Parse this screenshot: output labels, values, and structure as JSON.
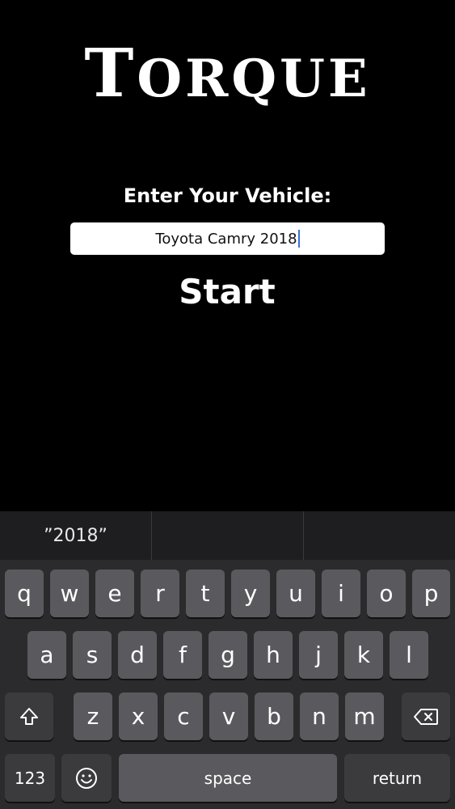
{
  "app": {
    "title_first": "T",
    "title_rest": "ORQUE"
  },
  "form": {
    "label": "Enter Your Vehicle:",
    "vehicle_value": "Toyota Camry 2018",
    "start_label": "Start"
  },
  "keyboard": {
    "suggestions": [
      "”2018”",
      "",
      ""
    ],
    "row1": [
      "q",
      "w",
      "e",
      "r",
      "t",
      "y",
      "u",
      "i",
      "o",
      "p"
    ],
    "row2": [
      "a",
      "s",
      "d",
      "f",
      "g",
      "h",
      "j",
      "k",
      "l"
    ],
    "row3": [
      "z",
      "x",
      "c",
      "v",
      "b",
      "n",
      "m"
    ],
    "numbers_label": "123",
    "space_label": "space",
    "return_label": "return",
    "icons": {
      "shift": "shift-icon",
      "delete": "delete-icon",
      "emoji": "emoji-icon"
    }
  }
}
